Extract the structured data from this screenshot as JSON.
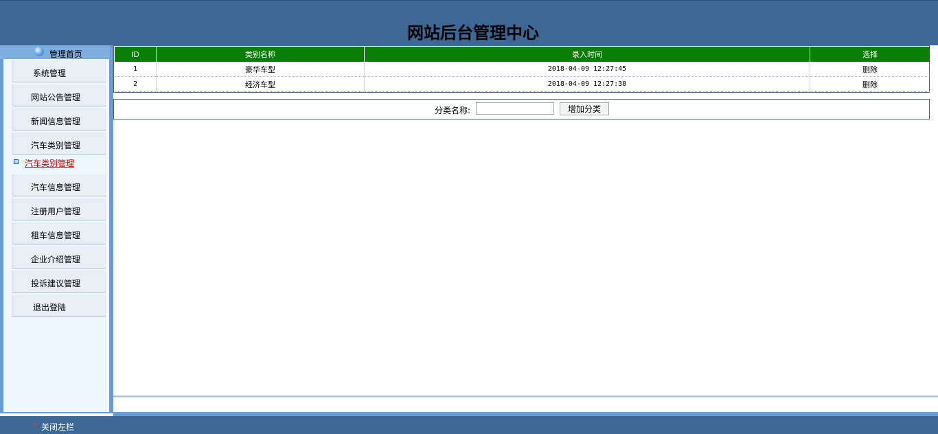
{
  "header": {
    "title": "网站后台管理中心"
  },
  "sidebar": {
    "home_label": "管理首页",
    "items": [
      {
        "label": "系统管理"
      },
      {
        "label": "网站公告管理"
      },
      {
        "label": "新闻信息管理"
      },
      {
        "label": "汽车类别管理"
      },
      {
        "label": "汽车信息管理"
      },
      {
        "label": "注册用户管理"
      },
      {
        "label": "租车信息管理"
      },
      {
        "label": "企业介绍管理"
      },
      {
        "label": "投诉建议管理"
      },
      {
        "label": "退出登陆"
      }
    ],
    "active_sub_item": {
      "label": "汽车类别管理"
    }
  },
  "table": {
    "columns": [
      "ID",
      "类别名称",
      "录入时间",
      "选择"
    ],
    "rows": [
      {
        "id": "1",
        "name": "豪华车型",
        "time": "2018-04-09 12:27:45",
        "action": "删除"
      },
      {
        "id": "2",
        "name": "经济车型",
        "time": "2018-04-09 12:27:38",
        "action": "删除"
      }
    ]
  },
  "form": {
    "label": "分类名称:",
    "input_value": "",
    "submit_label": "增加分类"
  },
  "footer": {
    "close_label": "关闭左栏"
  },
  "colors": {
    "header_bg": "#3d6794",
    "table_header_bg": "#0a7d06",
    "active_link": "#e00000"
  },
  "icons": {
    "home": "globe-icon",
    "close": "close-icon",
    "bullet": "square-bullet-icon"
  }
}
